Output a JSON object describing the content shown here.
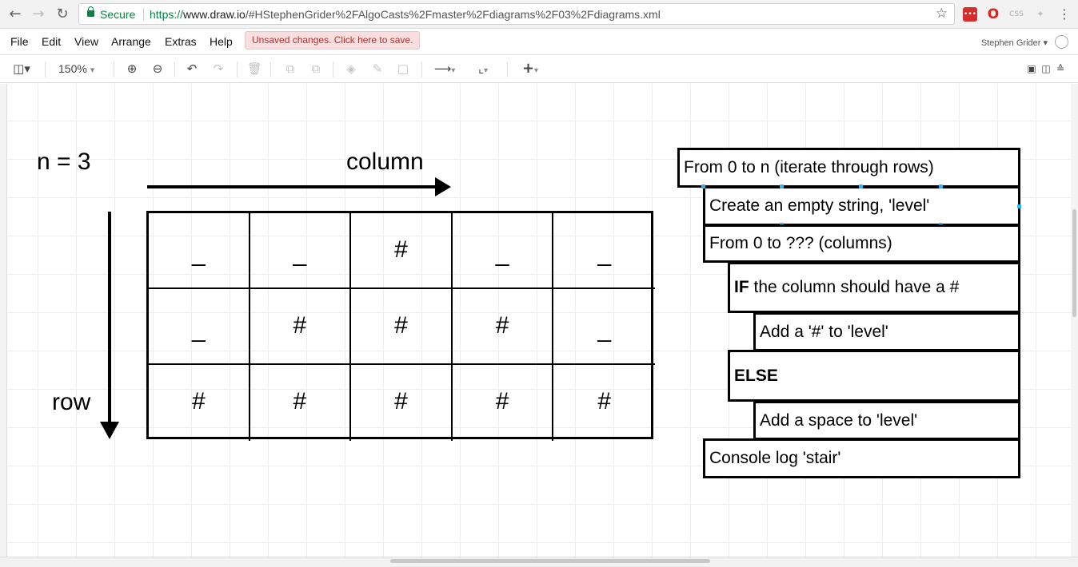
{
  "browser": {
    "secure_label": "Secure",
    "url_scheme": "https://",
    "url_host": "www.draw.io",
    "url_rest": "/#HStephenGrider%2FAlgoCasts%2Fmaster%2Fdiagrams%2F03%2Fdiagrams.xml",
    "back_icon": "back-arrow-icon",
    "forward_icon": "forward-arrow-icon",
    "reload_icon": "reload-icon",
    "extensions": [
      "lastpass-icon",
      "opera-icon",
      "css-icon",
      "feather-icon",
      "more-icon"
    ],
    "ext_css_label": "CSS"
  },
  "menu": {
    "items": [
      "File",
      "Edit",
      "View",
      "Arrange",
      "Extras",
      "Help"
    ],
    "unsaved_notice": "Unsaved changes. Click here to save.",
    "user_name": "Stephen Grider"
  },
  "toolbar": {
    "zoom_level": "150%"
  },
  "diagram": {
    "n_label": "n = 3",
    "column_label": "column",
    "row_label": "row",
    "grid": [
      [
        "_",
        "_",
        "#",
        "_",
        "_"
      ],
      [
        "_",
        "#",
        "#",
        "#",
        "_"
      ],
      [
        "#",
        "#",
        "#",
        "#",
        "#"
      ]
    ],
    "flow": {
      "step1": "From 0 to n (iterate through rows)",
      "step2": "Create an empty string, 'level'",
      "step3": "From 0 to ??? (columns)",
      "step4_bold": "IF",
      "step4_rest": " the column should have a #",
      "step5": "Add a '#' to 'level'",
      "step6_bold": "ELSE",
      "step7": "Add a space to 'level'",
      "step8": "Console log 'stair'"
    }
  },
  "colors": {
    "secure_green": "#0b8043",
    "notice_bg": "#f8dede",
    "notice_text": "#b03030",
    "selection_blue": "#29b6f2"
  }
}
